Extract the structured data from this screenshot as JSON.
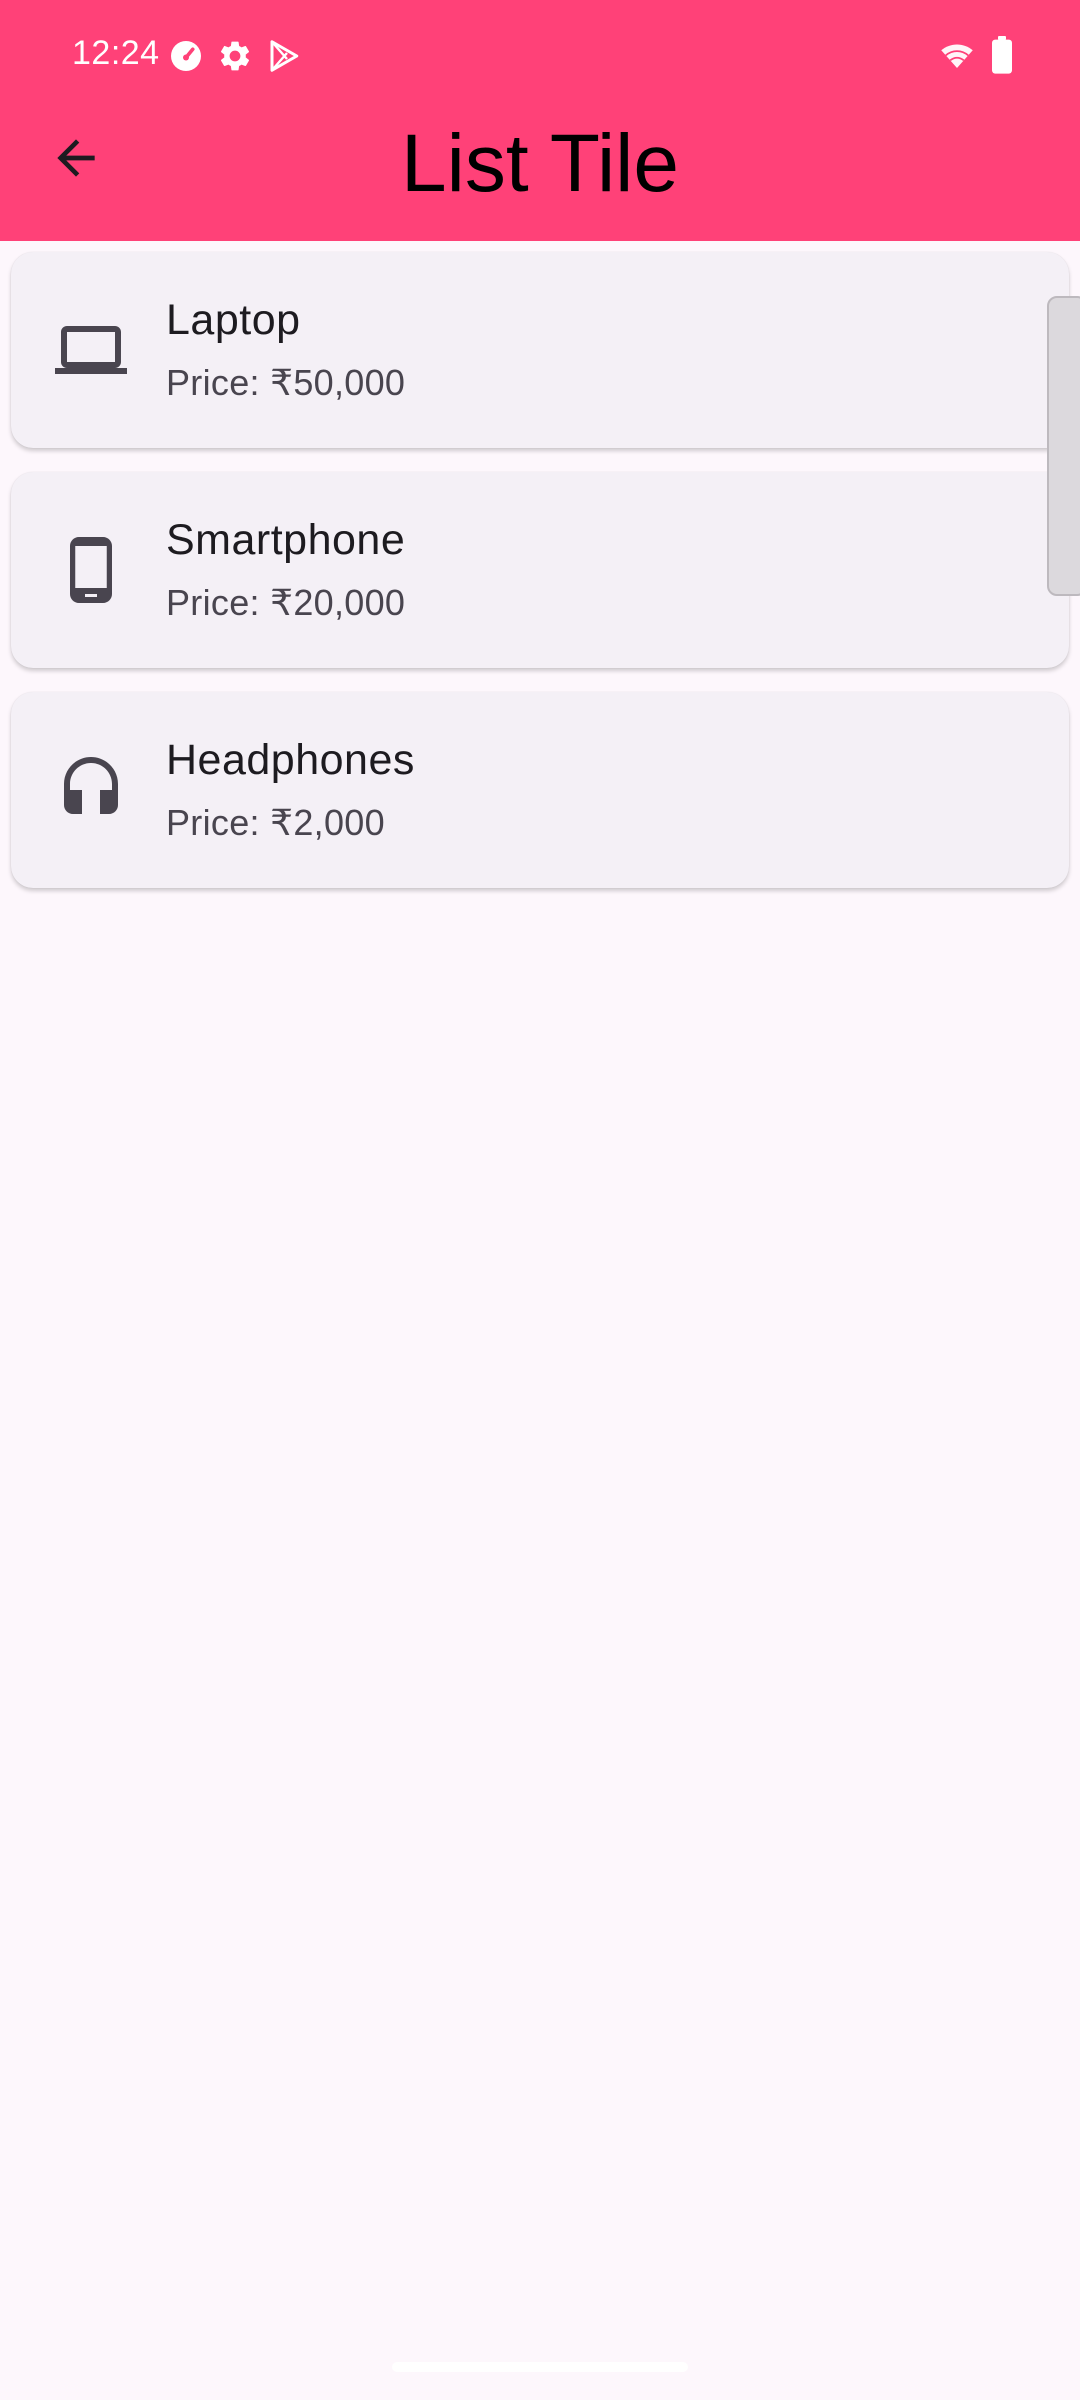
{
  "status_bar": {
    "time": "12:24",
    "icons": [
      "speedometer-icon",
      "gear-icon",
      "play-store-icon",
      "wifi-icon",
      "battery-icon"
    ]
  },
  "appbar": {
    "title": "List Tile",
    "back_icon": "arrow-back-icon",
    "color": "#ff4178"
  },
  "items": [
    {
      "title": "Laptop",
      "subtitle": "Price: ₹50,000",
      "icon": "laptop-icon"
    },
    {
      "title": "Smartphone",
      "subtitle": "Price: ₹20,000",
      "icon": "smartphone-icon"
    },
    {
      "title": "Headphones",
      "subtitle": "Price: ₹2,000",
      "icon": "headphones-icon"
    }
  ],
  "colors": {
    "background": "#fdf7fc",
    "card": "#f4f0f6",
    "title_text": "#1d1b20",
    "subtitle_text": "#49454f"
  }
}
